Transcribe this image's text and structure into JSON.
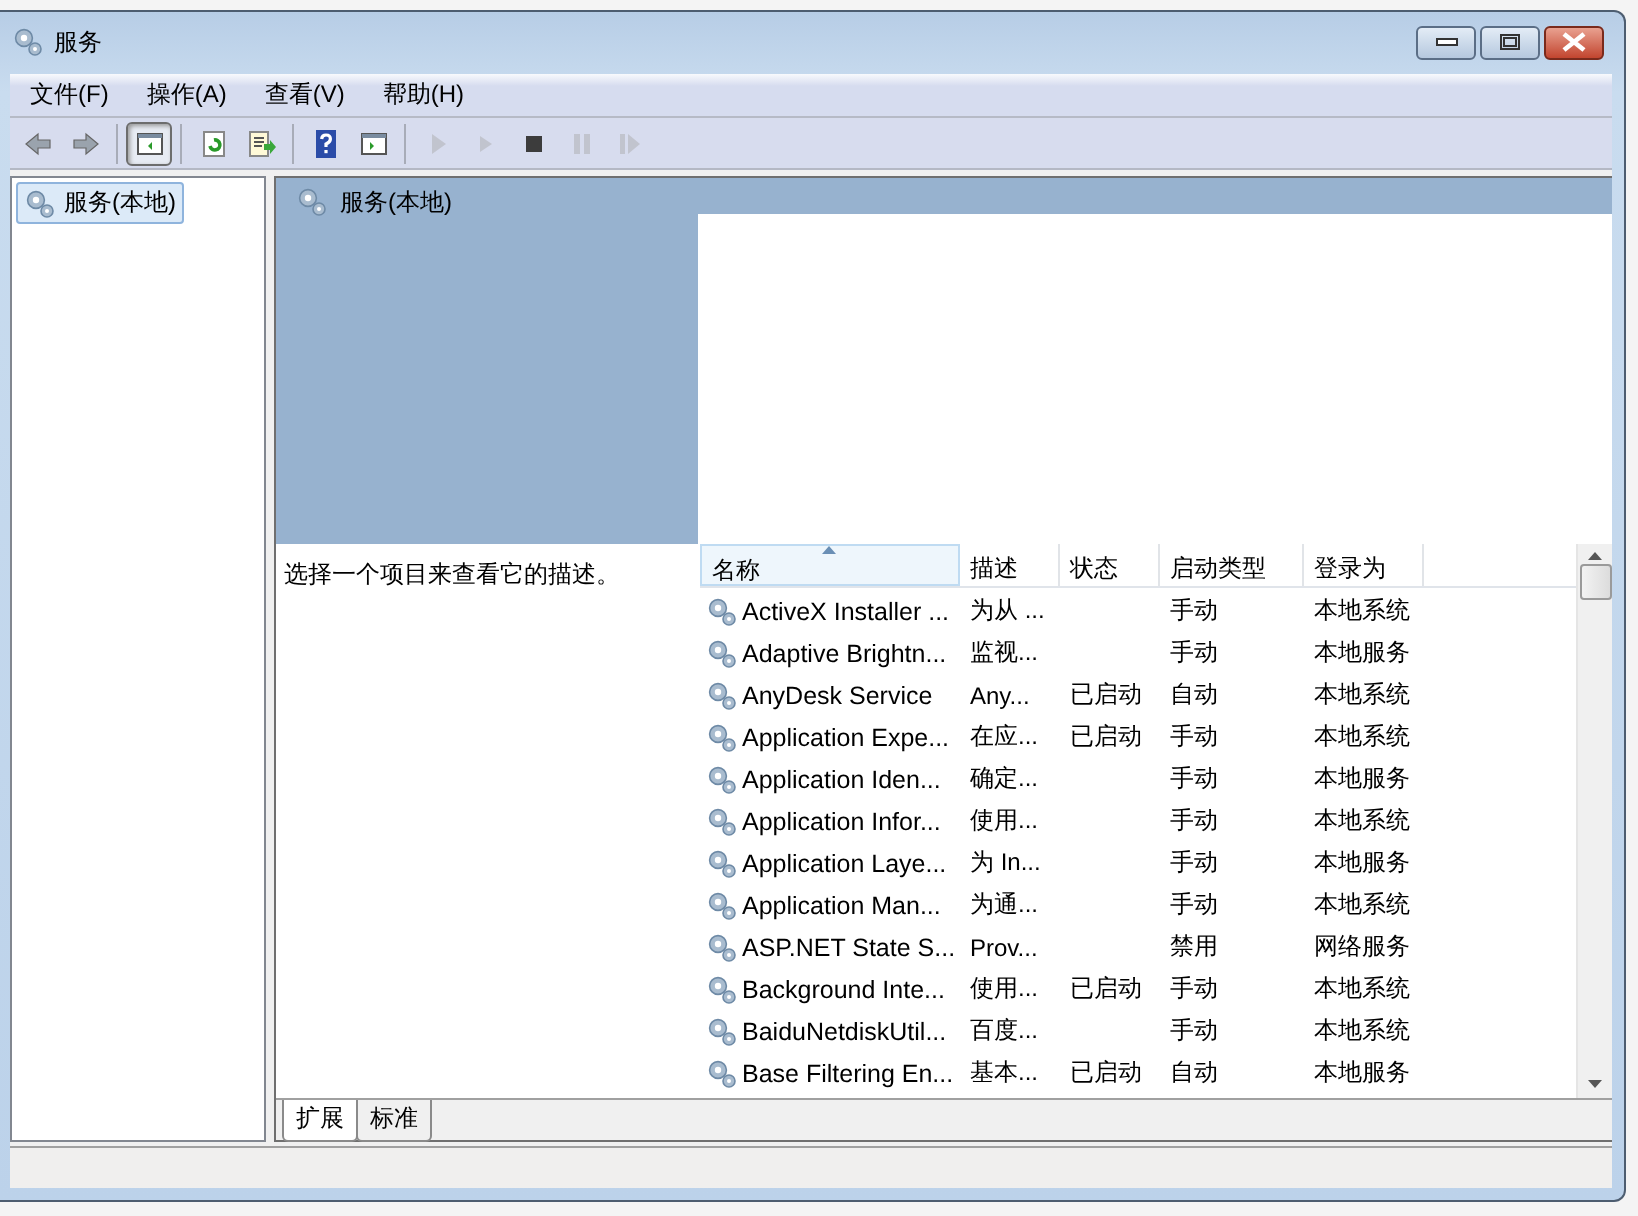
{
  "window": {
    "title": "服务"
  },
  "menu": [
    {
      "label": "文件(F)"
    },
    {
      "label": "操作(A)"
    },
    {
      "label": "查看(V)"
    },
    {
      "label": "帮助(H)"
    }
  ],
  "toolbar": [
    {
      "kind": "back",
      "disabled": false
    },
    {
      "kind": "forward",
      "disabled": false
    },
    {
      "kind": "sep"
    },
    {
      "kind": "tree",
      "pressed": true
    },
    {
      "kind": "sep"
    },
    {
      "kind": "refresh",
      "disabled": false
    },
    {
      "kind": "export",
      "disabled": false
    },
    {
      "kind": "sep"
    },
    {
      "kind": "help",
      "disabled": false
    },
    {
      "kind": "pane",
      "disabled": false
    },
    {
      "kind": "sep"
    },
    {
      "kind": "start",
      "disabled": true
    },
    {
      "kind": "start2",
      "disabled": true
    },
    {
      "kind": "stop",
      "disabled": false
    },
    {
      "kind": "pause",
      "disabled": true
    },
    {
      "kind": "resume",
      "disabled": true
    }
  ],
  "tree": {
    "items": [
      {
        "label": "服务(本地)",
        "selected": true
      }
    ]
  },
  "pane": {
    "title": "服务(本地)",
    "description": "选择一个项目来查看它的描述。"
  },
  "table": {
    "columns": [
      {
        "label": "名称",
        "sorted": true
      },
      {
        "label": "描述",
        "sorted": false
      },
      {
        "label": "状态",
        "sorted": false
      },
      {
        "label": "启动类型",
        "sorted": false
      },
      {
        "label": "登录为",
        "sorted": false
      }
    ],
    "rows": [
      {
        "name": "ActiveX Installer ...",
        "description": "为从 ...",
        "startup": "手动",
        "logon": "本地系统"
      },
      {
        "name": "Adaptive Brightn...",
        "description": "监视...",
        "startup": "手动",
        "logon": "本地服务"
      },
      {
        "name": "AnyDesk Service",
        "description": "Any...",
        "status": "已启动",
        "startup": "自动",
        "logon": "本地系统"
      },
      {
        "name": "Application Expe...",
        "description": "在应...",
        "status": "已启动",
        "startup": "手动",
        "logon": "本地系统"
      },
      {
        "name": "Application Iden...",
        "description": "确定...",
        "startup": "手动",
        "logon": "本地服务"
      },
      {
        "name": "Application Infor...",
        "description": "使用...",
        "startup": "手动",
        "logon": "本地系统"
      },
      {
        "name": "Application Laye...",
        "description": "为 In...",
        "startup": "手动",
        "logon": "本地服务"
      },
      {
        "name": "Application Man...",
        "description": "为通...",
        "startup": "手动",
        "logon": "本地系统"
      },
      {
        "name": "ASP.NET State S...",
        "description": "Prov...",
        "startup": "禁用",
        "logon": "网络服务"
      },
      {
        "name": "Background Inte...",
        "description": "使用...",
        "status": "已启动",
        "startup": "手动",
        "logon": "本地系统"
      },
      {
        "name": "BaiduNetdiskUtil...",
        "description": "百度...",
        "startup": "手动",
        "logon": "本地系统"
      },
      {
        "name": "Base Filtering En...",
        "description": "基本...",
        "status": "已启动",
        "startup": "自动",
        "logon": "本地服务"
      }
    ]
  },
  "tabs": [
    {
      "label": "扩展",
      "selected": true
    },
    {
      "label": "标准",
      "selected": false
    }
  ]
}
